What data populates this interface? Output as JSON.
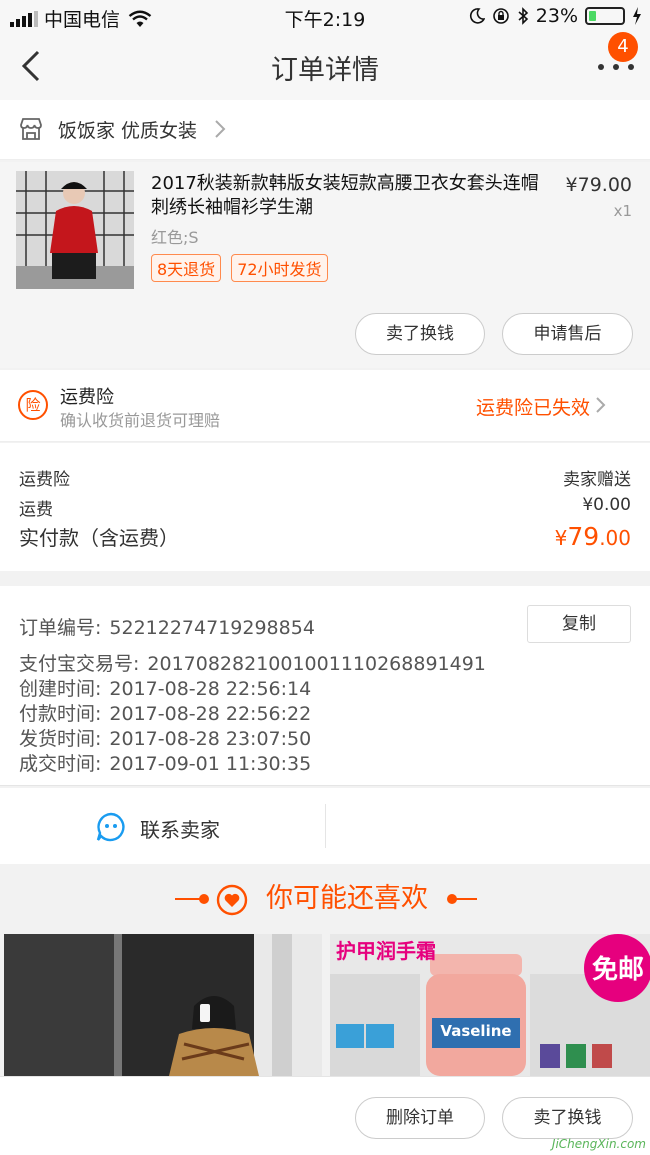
{
  "status_bar": {
    "carrier": "中国电信",
    "time": "下午2:19",
    "battery_percent": "23%",
    "battery_level": 0.23
  },
  "nav": {
    "title": "订单详情",
    "badge": "4"
  },
  "shop": {
    "name": "饭饭家 优质女装"
  },
  "item": {
    "name": "2017秋装新款韩版女装短款高腰卫衣女套头连帽刺绣长袖帽衫学生潮",
    "price": "¥79.00",
    "qty": "x1",
    "sku": "红色;S",
    "tags": [
      "8天退货",
      "72小时发货"
    ],
    "buttons": [
      "卖了换钱",
      "申请售后"
    ]
  },
  "insurance": {
    "title": "运费险",
    "desc": "确认收货前退货可理赔",
    "status": "运费险已失效"
  },
  "fees": {
    "rows": [
      {
        "label": "运费险",
        "value": "卖家赠送"
      },
      {
        "label": "运费",
        "value": "¥0.00"
      }
    ],
    "total_label": "实付款（含运费）",
    "total_currency": "¥",
    "total_int": "79",
    "total_dec": ".00"
  },
  "order": {
    "number_label": "订单编号:",
    "number": "52212274719298854",
    "copy": "复制",
    "alipay_label": "支付宝交易号:",
    "alipay": "2017082821001001110268891491",
    "created_label": "创建时间:",
    "created": "2017-08-28 22:56:14",
    "paid_label": "付款时间:",
    "paid": "2017-08-28 22:56:22",
    "shipped_label": "发货时间:",
    "shipped": "2017-08-28 23:07:50",
    "closed_label": "成交时间:",
    "closed": "2017-09-01 11:30:35"
  },
  "contact": {
    "label": "联系卖家"
  },
  "recommend": {
    "title": "你可能还喜欢",
    "product2_caption": "护甲润手霜",
    "product2_badge": "免邮",
    "product2_brand": "Vaseline"
  },
  "bottom": {
    "buttons": [
      "删除订单",
      "卖了换钱"
    ],
    "watermark": "JiChengXin.com"
  },
  "colors": {
    "accent": "#ff5000",
    "battery": "#4cd964"
  }
}
